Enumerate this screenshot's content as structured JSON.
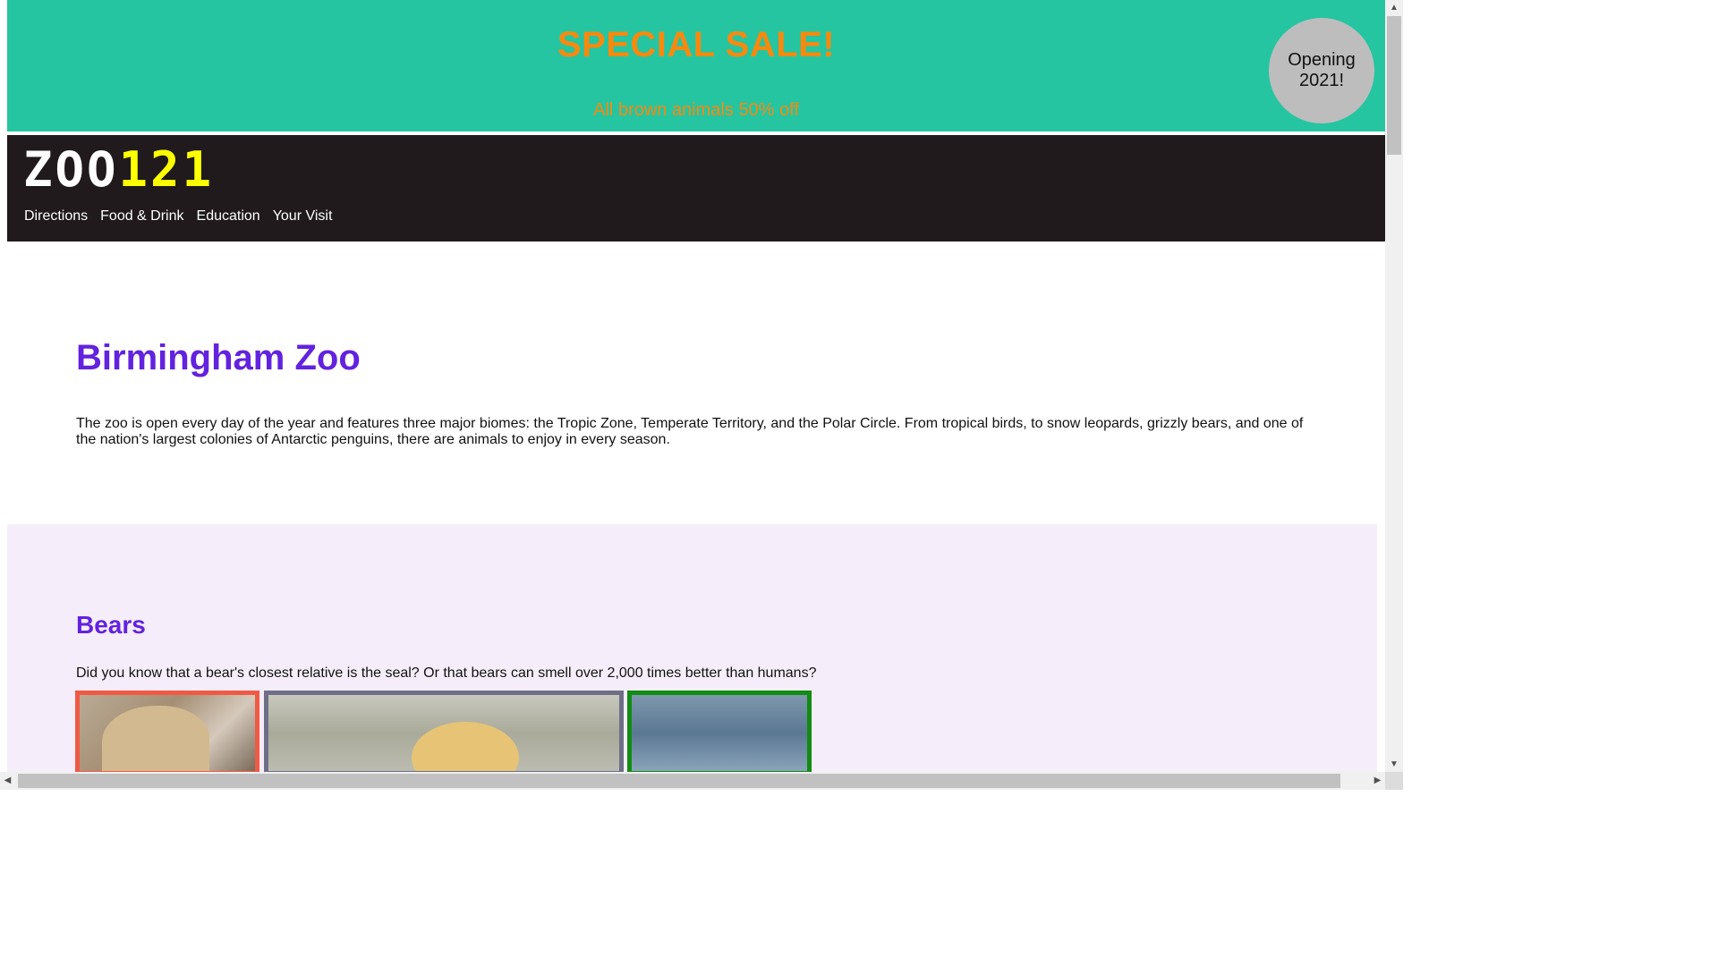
{
  "banner": {
    "title": "SPECIAL SALE!",
    "subtitle": "All brown animals 50% off",
    "badge": "Opening 2021!"
  },
  "logo": {
    "white_part": "ZOO",
    "yellow_part": "121"
  },
  "nav": {
    "items": [
      "Directions",
      "Food & Drink",
      "Education",
      "Your Visit"
    ]
  },
  "hero": {
    "title": "Birmingham Zoo",
    "description": "The zoo is open every day of the year and features three major biomes: the Tropic Zone, Temperate Territory, and the Polar Circle. From tropical birds, to snow leopards, grizzly bears, and one of the nation's largest colonies of Antarctic penguins, there are animals to enjoy in every season."
  },
  "bears": {
    "title": "Bears",
    "description": "Did you know that a bear's closest relative is the seal? Or that bears can smell over 2,000 times better than humans?"
  },
  "colors": {
    "banner": "#25c5a1",
    "nav": "#201a1d",
    "accent": "#6222df",
    "sale_text": "#f7890f",
    "logo_highlight": "#ffff00"
  },
  "icons": {
    "scroll_up": "scroll-up-arrow-icon",
    "scroll_down": "scroll-down-arrow-icon",
    "scroll_left": "scroll-left-arrow-icon",
    "scroll_right": "scroll-right-arrow-icon"
  }
}
